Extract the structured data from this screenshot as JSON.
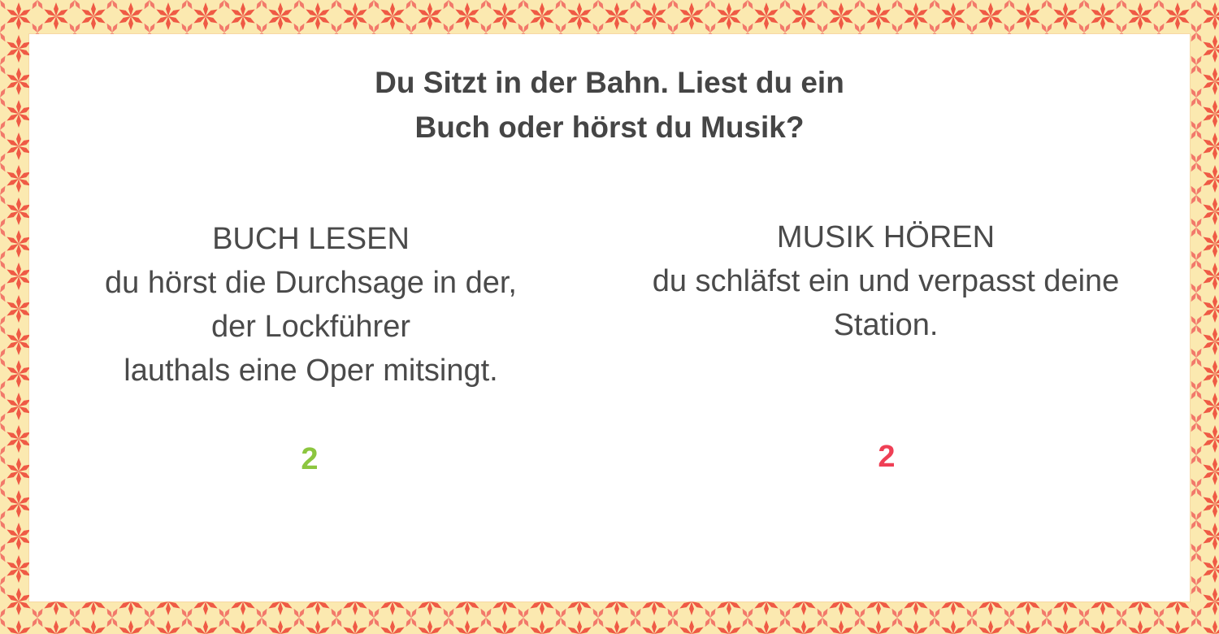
{
  "question": {
    "line1": "Du Sitzt in der Bahn. Liest du ein",
    "line2": "Buch oder hörst du Musik?"
  },
  "options": [
    {
      "title": "BUCH LESEN",
      "lines": [
        "du hörst die Durchsage in der,",
        "der Lockführer",
        "lauthals eine Oper mitsingt."
      ],
      "score": "2",
      "score_color": "#8cc63f"
    },
    {
      "title": "MUSIK HÖREN",
      "lines": [
        "du schläfst ein und verpasst deine",
        "Station."
      ],
      "score": "2",
      "score_color": "#ef3f55"
    }
  ],
  "colors": {
    "text": "#454545",
    "border_base": "#fbe9b0",
    "border_pattern": "#ef5a45"
  }
}
